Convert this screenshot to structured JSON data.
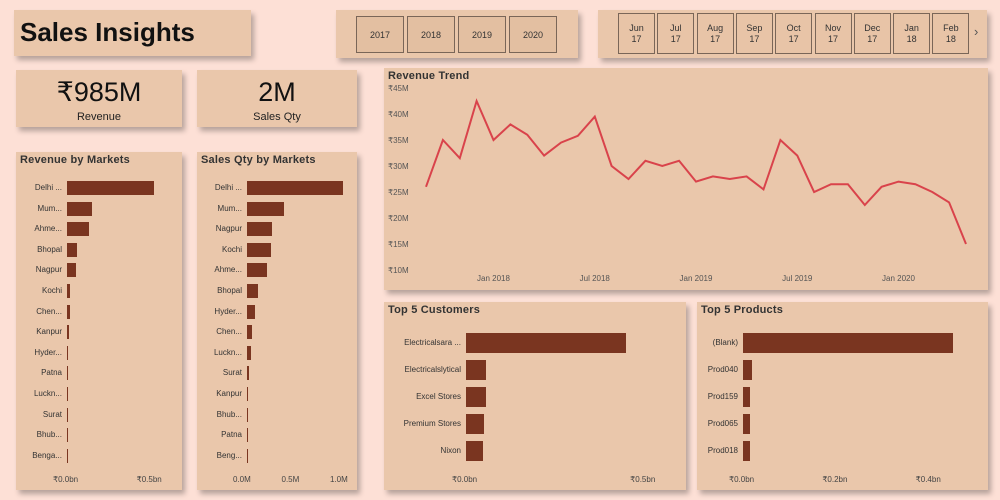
{
  "header": {
    "title": "Sales Insights"
  },
  "year_slicer": {
    "years": [
      "2017",
      "2018",
      "2019",
      "2020"
    ]
  },
  "month_slicer": {
    "months": [
      {
        "m": "Jun",
        "y": "17"
      },
      {
        "m": "Jul",
        "y": "17"
      },
      {
        "m": "Aug",
        "y": "17"
      },
      {
        "m": "Sep",
        "y": "17"
      },
      {
        "m": "Oct",
        "y": "17"
      },
      {
        "m": "Nov",
        "y": "17"
      },
      {
        "m": "Dec",
        "y": "17"
      },
      {
        "m": "Jan",
        "y": "18"
      },
      {
        "m": "Feb",
        "y": "18"
      }
    ],
    "next_icon": "›"
  },
  "kpis": {
    "revenue": {
      "value": "₹985M",
      "label": "Revenue"
    },
    "qty": {
      "value": "2M",
      "label": "Sales Qty"
    }
  },
  "chart_data": [
    {
      "id": "revenue_by_markets",
      "type": "bar",
      "orientation": "horizontal",
      "title": "Revenue by Markets",
      "categories": [
        "Delhi ...",
        "Mum...",
        "Ahme...",
        "Bhopal",
        "Nagpur",
        "Kochi",
        "Chen...",
        "Kanpur",
        "Hyder...",
        "Patna",
        "Luckn...",
        "Surat",
        "Bhub...",
        "Benga..."
      ],
      "values": [
        0.52,
        0.15,
        0.13,
        0.06,
        0.055,
        0.018,
        0.016,
        0.012,
        0.008,
        0.004,
        0.003,
        0.002,
        0.002,
        0.001
      ],
      "xlim": [
        0,
        0.55
      ],
      "xticks": [
        {
          "v": 0,
          "label": "₹0.0bn"
        },
        {
          "v": 0.5,
          "label": "₹0.5bn"
        }
      ]
    },
    {
      "id": "qty_by_markets",
      "type": "bar",
      "orientation": "horizontal",
      "title": "Sales Qty by Markets",
      "categories": [
        "Delhi ...",
        "Mum...",
        "Nagpur",
        "Kochi",
        "Ahme...",
        "Bhopal",
        "Hyder...",
        "Chen...",
        "Luckn...",
        "Surat",
        "Kanpur",
        "Bhub...",
        "Patna",
        "Beng..."
      ],
      "values": [
        0.99,
        0.38,
        0.26,
        0.25,
        0.21,
        0.11,
        0.08,
        0.05,
        0.04,
        0.02,
        0.015,
        0.012,
        0.008,
        0.005
      ],
      "xlim": [
        0,
        1.0
      ],
      "xticks": [
        {
          "v": 0,
          "label": "0.0M"
        },
        {
          "v": 0.5,
          "label": "0.5M"
        },
        {
          "v": 1.0,
          "label": "1.0M"
        }
      ]
    },
    {
      "id": "revenue_trend",
      "type": "line",
      "title": "Revenue Trend",
      "y": [
        26,
        35,
        31.5,
        42.5,
        35,
        38,
        36,
        32,
        34.5,
        35.8,
        39.5,
        30,
        27.5,
        31,
        30,
        31,
        27,
        28,
        27.5,
        28,
        25.5,
        35,
        32,
        25,
        26.5,
        26.5,
        22.5,
        26,
        27,
        26.5,
        25,
        23,
        15
      ],
      "ylim": [
        10,
        45
      ],
      "yticks": [
        "₹10M",
        "₹15M",
        "₹20M",
        "₹25M",
        "₹30M",
        "₹35M",
        "₹40M",
        "₹45M"
      ],
      "xticks": [
        {
          "i": 4,
          "label": "Jan 2018"
        },
        {
          "i": 10,
          "label": "Jul 2018"
        },
        {
          "i": 16,
          "label": "Jan 2019"
        },
        {
          "i": 22,
          "label": "Jul 2019"
        },
        {
          "i": 28,
          "label": "Jan 2020"
        }
      ],
      "color": "#d9434b"
    },
    {
      "id": "top_customers",
      "type": "bar",
      "orientation": "horizontal",
      "title": "Top 5 Customers",
      "categories": [
        "Electricalsara ...",
        "Electricalslytical",
        "Excel Stores",
        "Premium Stores",
        "Nixon"
      ],
      "values": [
        0.45,
        0.055,
        0.055,
        0.05,
        0.048
      ],
      "xlim": [
        0,
        0.55
      ],
      "xticks": [
        {
          "v": 0,
          "label": "₹0.0bn"
        },
        {
          "v": 0.5,
          "label": "₹0.5bn"
        }
      ]
    },
    {
      "id": "top_products",
      "type": "bar",
      "orientation": "horizontal",
      "title": "Top 5 Products",
      "categories": [
        "(Blank)",
        "Prod040",
        "Prod159",
        "Prod065",
        "Prod018"
      ],
      "values": [
        0.45,
        0.02,
        0.015,
        0.015,
        0.014
      ],
      "xlim": [
        0,
        0.48
      ],
      "xticks": [
        {
          "v": 0,
          "label": "₹0.0bn"
        },
        {
          "v": 0.2,
          "label": "₹0.2bn"
        },
        {
          "v": 0.4,
          "label": "₹0.4bn"
        }
      ]
    }
  ],
  "colors": {
    "background": "#fde0d6",
    "card": "#eac7ab",
    "bar": "#7a3520",
    "line": "#d9434b"
  }
}
